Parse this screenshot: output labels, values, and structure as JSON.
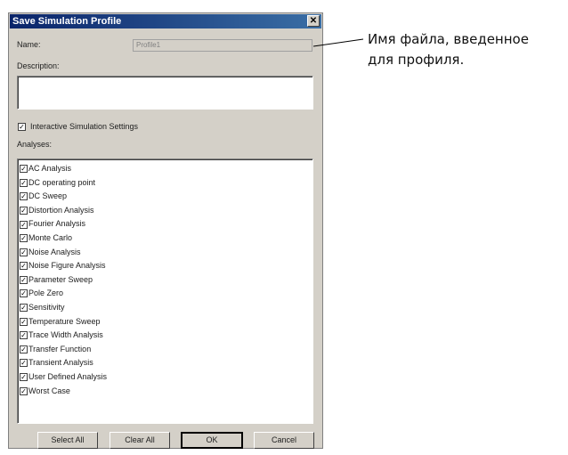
{
  "dialog": {
    "title": "Save Simulation Profile",
    "close_glyph": "✕",
    "name_label": "Name:",
    "name_value": "Profile1",
    "description_label": "Description:",
    "description_value": "",
    "interactive_settings": {
      "label": "Interactive Simulation Settings",
      "checked": true
    },
    "analyses_label": "Analyses:",
    "analyses": [
      {
        "label": "AC Analysis",
        "checked": true
      },
      {
        "label": "DC operating point",
        "checked": true
      },
      {
        "label": "DC Sweep",
        "checked": true
      },
      {
        "label": "Distortion Analysis",
        "checked": true
      },
      {
        "label": "Fourier Analysis",
        "checked": true
      },
      {
        "label": "Monte Carlo",
        "checked": true
      },
      {
        "label": "Noise Analysis",
        "checked": true
      },
      {
        "label": "Noise Figure Analysis",
        "checked": true
      },
      {
        "label": "Parameter Sweep",
        "checked": true
      },
      {
        "label": "Pole Zero",
        "checked": true
      },
      {
        "label": "Sensitivity",
        "checked": true
      },
      {
        "label": "Temperature Sweep",
        "checked": true
      },
      {
        "label": "Trace Width Analysis",
        "checked": true
      },
      {
        "label": "Transfer Function",
        "checked": true
      },
      {
        "label": "Transient Analysis",
        "checked": true
      },
      {
        "label": "User Defined Analysis",
        "checked": true
      },
      {
        "label": "Worst Case",
        "checked": true
      }
    ],
    "buttons": {
      "select_all": "Select All",
      "clear_all": "Clear All",
      "ok": "OK",
      "cancel": "Cancel"
    }
  },
  "annotation": {
    "line1": "Имя файла, введенное",
    "line2": "для профиля."
  }
}
